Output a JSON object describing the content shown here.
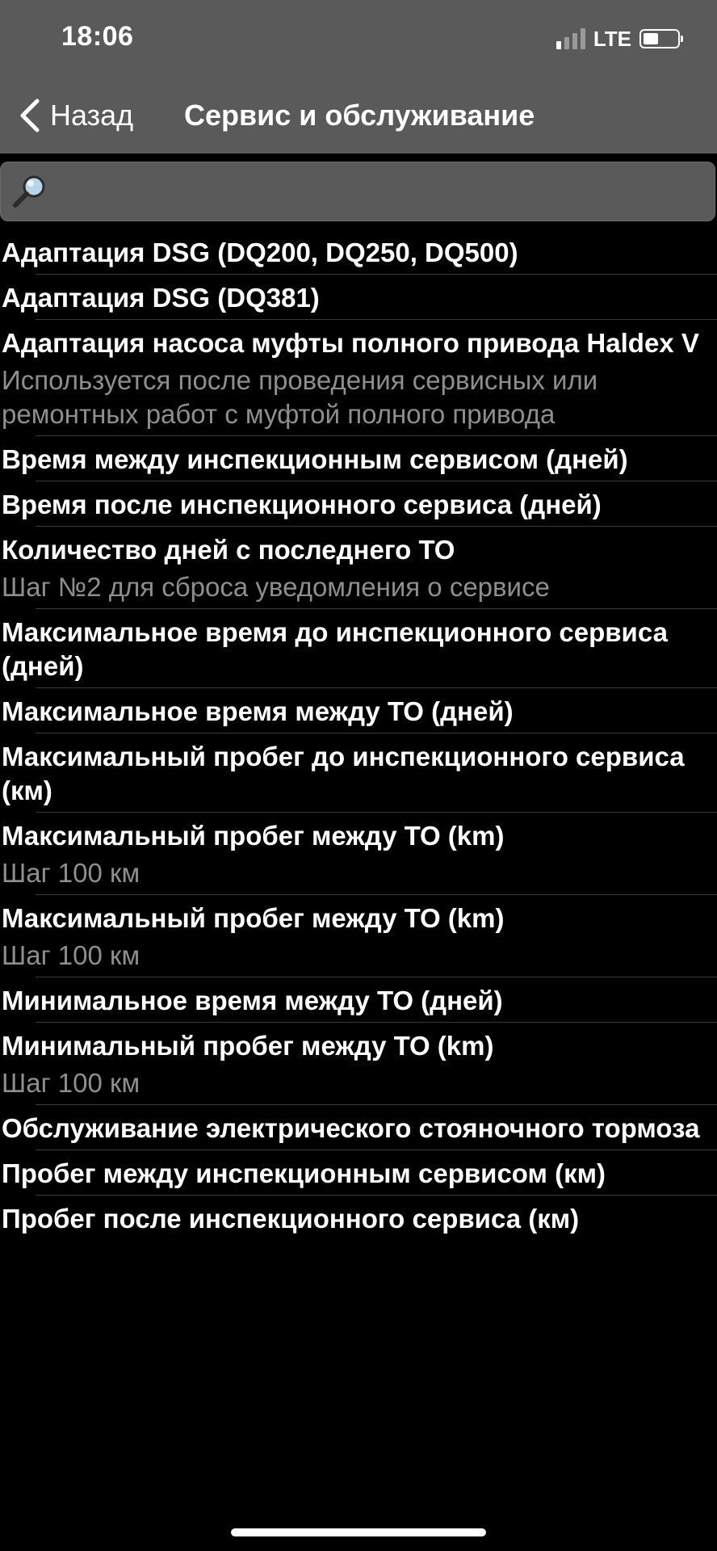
{
  "status_bar": {
    "time": "18:06",
    "network": "LTE",
    "signal_bars_active": 1,
    "signal_bars_total": 4,
    "battery_level": 0.45
  },
  "nav": {
    "back_label": "Назад",
    "title": "Сервис и обслуживание"
  },
  "search": {
    "value": "",
    "placeholder": ""
  },
  "items": [
    {
      "title": "Адаптация DSG (DQ200, DQ250, DQ500)",
      "subtitle": ""
    },
    {
      "title": "Адаптация DSG (DQ381)",
      "subtitle": ""
    },
    {
      "title": "Адаптация насоса муфты полного привода Haldex V",
      "subtitle": "Используется после проведения сервисных или ремонтных работ с муфтой полного привода"
    },
    {
      "title": "Время между инспекционным сервисом (дней)",
      "subtitle": ""
    },
    {
      "title": "Время после инспекционного сервиса (дней)",
      "subtitle": ""
    },
    {
      "title": "Количество дней с последнего ТО",
      "subtitle": "Шаг №2 для сброса уведомления о сервисе"
    },
    {
      "title": "Максимальное время до инспекционного сервиса (дней)",
      "subtitle": ""
    },
    {
      "title": "Максимальное время между ТО (дней)",
      "subtitle": ""
    },
    {
      "title": "Максимальный пробег до инспекционного сервиса (км)",
      "subtitle": ""
    },
    {
      "title": "Максимальный пробег между ТО (km)",
      "subtitle": "Шаг 100 км"
    },
    {
      "title": "Максимальный пробег между ТО (km)",
      "subtitle": "Шаг 100 км"
    },
    {
      "title": "Минимальное время между ТО (дней)",
      "subtitle": ""
    },
    {
      "title": "Минимальный пробег между ТО (km)",
      "subtitle": "Шаг 100 км"
    },
    {
      "title": "Обслуживание электрического стояночного тормоза",
      "subtitle": ""
    },
    {
      "title": "Пробег между инспекционным сервисом (км)",
      "subtitle": ""
    },
    {
      "title": "Пробег после инспекционного сервиса (км)",
      "subtitle": ""
    }
  ],
  "colors": {
    "background": "#000000",
    "header": "#5a5a5a",
    "subtitle": "#8e8e8e",
    "separator": "#3a3a3a"
  }
}
